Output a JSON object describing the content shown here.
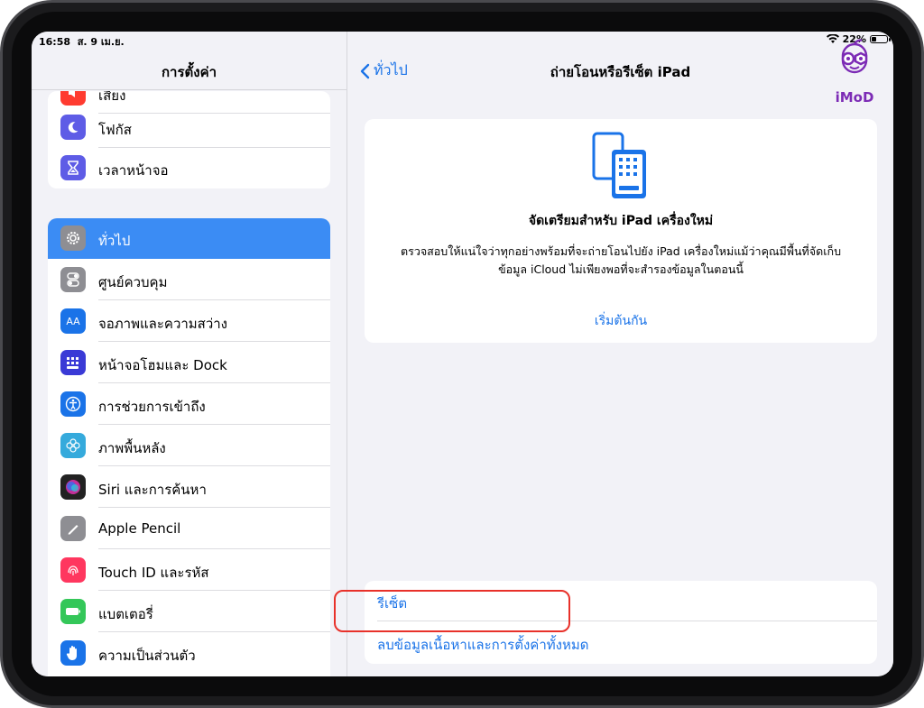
{
  "status_bar": {
    "time": "16:58",
    "date": "ส. 9 เม.ย.",
    "battery": "22%"
  },
  "sidebar": {
    "title": "การตั้งค่า",
    "partial_item_label": "เสียง",
    "group1": [
      {
        "label": "โฟกัส",
        "icon": "moon-icon",
        "color": "#5e5ce6"
      },
      {
        "label": "เวลาหน้าจอ",
        "icon": "hourglass-icon",
        "color": "#5e5ce6"
      }
    ],
    "group2": [
      {
        "label": "ทั่วไป",
        "icon": "gear-icon",
        "color": "#8e8e93",
        "selected": true
      },
      {
        "label": "ศูนย์ควบคุม",
        "icon": "toggles-icon",
        "color": "#8e8e93"
      },
      {
        "label": "จอภาพและความสว่าง",
        "icon": "text-size-icon",
        "color": "#1a73e8"
      },
      {
        "label": "หน้าจอโฮมและ Dock",
        "icon": "grid-icon",
        "color": "#3a3ad6"
      },
      {
        "label": "การช่วยการเข้าถึง",
        "icon": "accessibility-icon",
        "color": "#1a73e8"
      },
      {
        "label": "ภาพพื้นหลัง",
        "icon": "flower-icon",
        "color": "#35aadc"
      },
      {
        "label": "Siri และการค้นหา",
        "icon": "siri-icon",
        "color": "#222222"
      },
      {
        "label": "Apple Pencil",
        "icon": "pencil-icon",
        "color": "#8e8e93"
      },
      {
        "label": "Touch ID และรหัส",
        "icon": "fingerprint-icon",
        "color": "#ff375f"
      },
      {
        "label": "แบตเตอรี่",
        "icon": "battery-icon",
        "color": "#34c759"
      },
      {
        "label": "ความเป็นส่วนตัว",
        "icon": "hand-icon",
        "color": "#1a73e8"
      }
    ]
  },
  "detail": {
    "back_label": "ทั่วไป",
    "title": "ถ่ายโอนหรือรีเซ็ต iPad",
    "logo_text": "iMoD",
    "card": {
      "title": "จัดเตรียมสำหรับ iPad เครื่องใหม่",
      "body_line1": "ตรวจสอบให้แน่ใจว่าทุกอย่างพร้อมที่จะถ่ายโอนไปยัง iPad เครื่องใหม่แม้ว่าคุณมีพื้นที่จัดเก็บ",
      "body_line2": "ข้อมูล iCloud ไม่เพียงพอที่จะสำรองข้อมูลในตอนนี้",
      "link": "เริ่มต้นกัน"
    },
    "reset_rows": [
      {
        "label": "รีเซ็ต"
      },
      {
        "label": "ลบข้อมูลเนื้อหาและการตั้งค่าทั้งหมด"
      }
    ]
  },
  "colors": {
    "accent": "#1a73e8",
    "selected": "#3b8cf4",
    "highlight": "#e8312a"
  }
}
